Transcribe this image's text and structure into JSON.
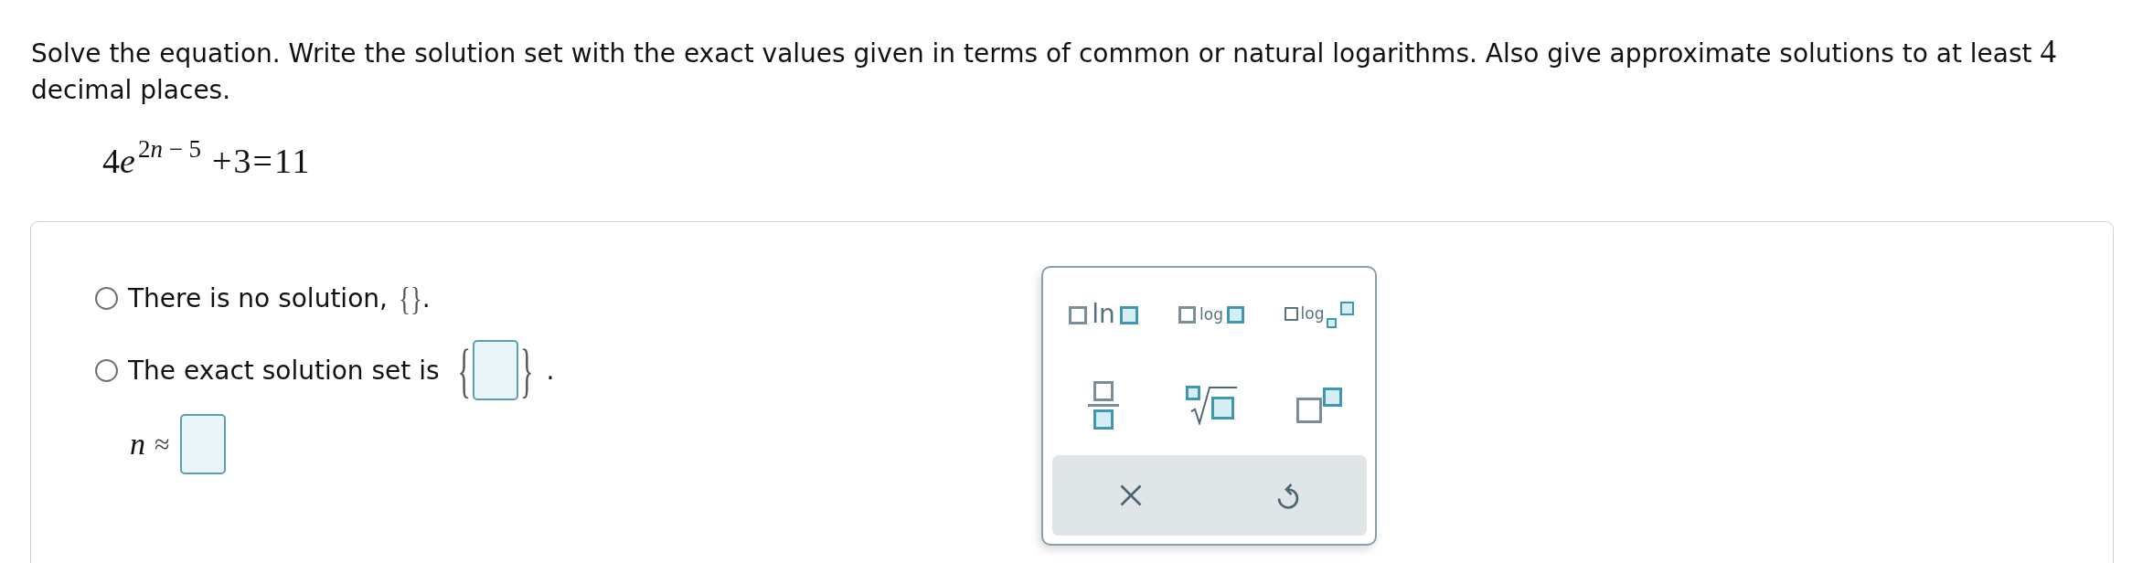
{
  "instructions": {
    "text": "Solve the equation. Write the solution set with the exact values given in terms of common or natural logarithms. Also give approximate solutions to at least",
    "number": "4",
    "text_after": "decimal places."
  },
  "equation": {
    "coefficient": "4",
    "base": "e",
    "exponent": {
      "coefficient": "2",
      "variable": "n",
      "rest": "− 5"
    },
    "rest": "+3=11"
  },
  "options": [
    {
      "kind": "empty_set",
      "label": "There is no solution,",
      "set": "{}",
      "end": ".",
      "selected": false
    },
    {
      "kind": "set_input",
      "label": "The exact solution set is",
      "open": "{",
      "close": "}",
      "end": ".",
      "selected": false
    }
  ],
  "approximation": {
    "variable": "n",
    "relation": "≈"
  },
  "palette": {
    "buttons": [
      {
        "kind": "ln",
        "label": "ln"
      },
      {
        "kind": "log",
        "label": "log"
      },
      {
        "kind": "log_base",
        "label": "log"
      },
      {
        "kind": "fraction"
      },
      {
        "kind": "root"
      },
      {
        "kind": "power"
      }
    ],
    "actions": [
      {
        "kind": "clear"
      },
      {
        "kind": "undo"
      }
    ]
  }
}
